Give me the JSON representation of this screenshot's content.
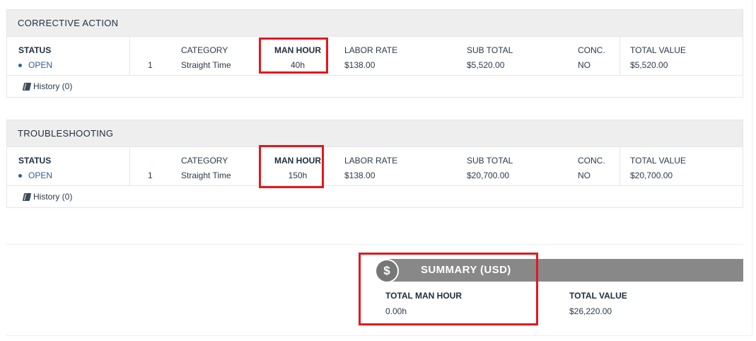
{
  "sections": [
    {
      "title": "CORRECTIVE ACTION",
      "status_label": "STATUS",
      "status_value": "OPEN",
      "index": "1",
      "category_label": "CATEGORY",
      "category_value": "Straight Time",
      "man_hour_label": "MAN HOUR",
      "man_hour_value": "40h",
      "labor_rate_label": "LABOR RATE",
      "labor_rate_value": "$138.00",
      "sub_total_label": "SUB TOTAL",
      "sub_total_value": "$5,520.00",
      "conc_label": "CONC.",
      "conc_value": "NO",
      "total_value_label": "TOTAL VALUE",
      "total_value_value": "$5,520.00",
      "history": "History (0)"
    },
    {
      "title": "TROUBLESHOOTING",
      "status_label": "STATUS",
      "status_value": "OPEN",
      "index": "1",
      "category_label": "CATEGORY",
      "category_value": "Straight Time",
      "man_hour_label": "MAN HOUR",
      "man_hour_value": "150h",
      "labor_rate_label": "LABOR RATE",
      "labor_rate_value": "$138.00",
      "sub_total_label": "SUB TOTAL",
      "sub_total_value": "$20,700.00",
      "conc_label": "CONC.",
      "conc_value": "NO",
      "total_value_label": "TOTAL VALUE",
      "total_value_value": "$20,700.00",
      "history": "History (0)"
    }
  ],
  "summary": {
    "icon_glyph": "$",
    "title": "SUMMARY (USD)",
    "total_man_hour_label": "TOTAL MAN HOUR",
    "total_man_hour_value": "0.00h",
    "total_value_label": "TOTAL VALUE",
    "total_value_value": "$26,220.00"
  },
  "colors": {
    "status_open": "#2d5f9a",
    "highlight_box": "#e0191f",
    "summary_bar": "#888888"
  },
  "icons": {
    "history": "book-icon",
    "summary": "dollar-icon"
  }
}
